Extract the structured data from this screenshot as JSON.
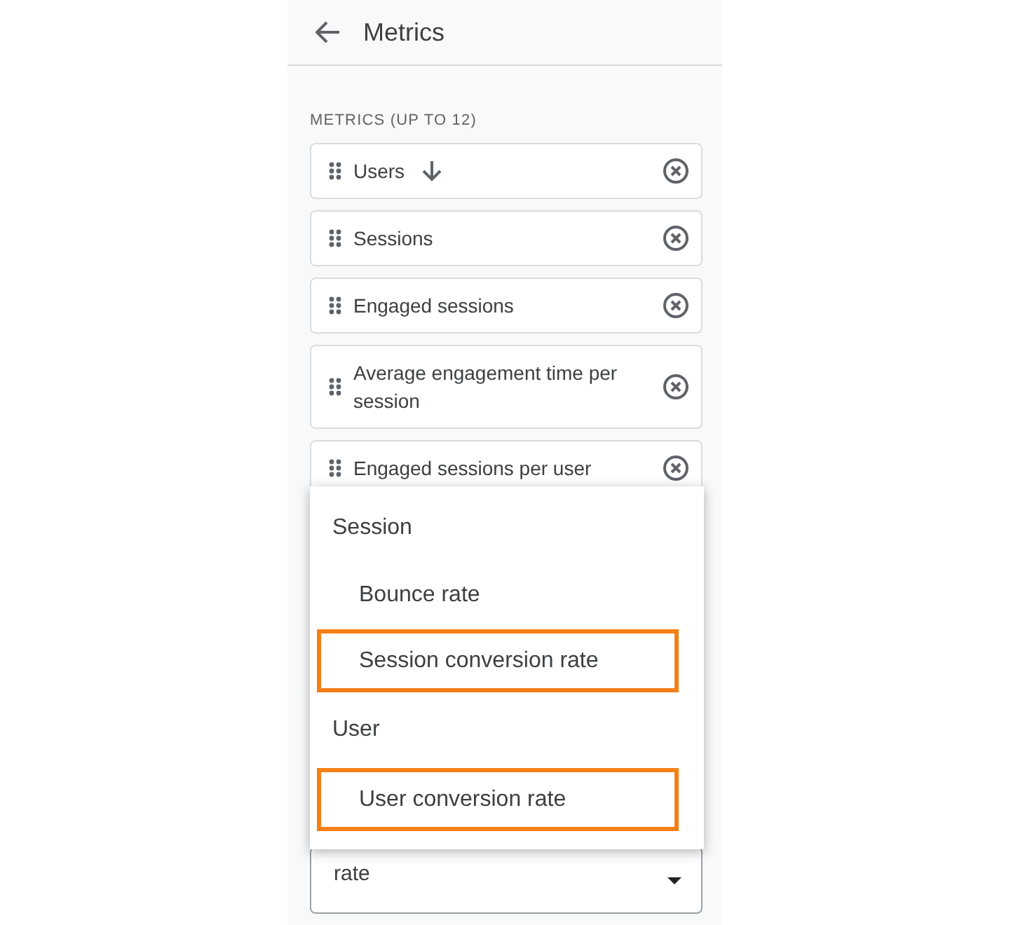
{
  "header": {
    "title": "Metrics"
  },
  "section_label": "METRICS (UP TO 12)",
  "metrics": [
    {
      "name": "Users",
      "sorted": true
    },
    {
      "name": "Sessions",
      "sorted": false
    },
    {
      "name": "Engaged sessions",
      "sorted": false
    },
    {
      "name": "Average engagement time per session",
      "sorted": false
    },
    {
      "name": "Engaged sessions per user",
      "sorted": false
    }
  ],
  "menu": {
    "groups": [
      {
        "label": "Session",
        "items": [
          {
            "label": "Bounce rate",
            "highlighted": false
          },
          {
            "label": "Session conversion rate",
            "highlighted": true
          }
        ]
      },
      {
        "label": "User",
        "items": [
          {
            "label": "User conversion rate",
            "highlighted": true
          }
        ]
      }
    ]
  },
  "search_field": {
    "value": "rate"
  }
}
